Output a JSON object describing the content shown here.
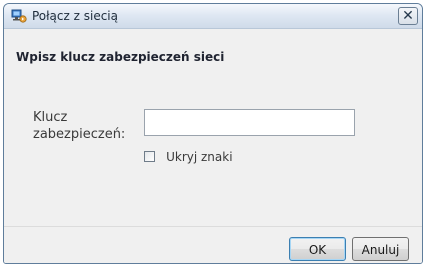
{
  "window": {
    "title": "Połącz z siecią",
    "close_label": "✕"
  },
  "main": {
    "heading": "Wpisz klucz zabezpieczeń sieci",
    "key_label": "Klucz zabezpieczeń:",
    "key_value": "",
    "hide_chars_label": "Ukryj znaki",
    "hide_chars_checked": false
  },
  "footer": {
    "ok_label": "OK",
    "cancel_label": "Anuluj"
  },
  "icons": {
    "app": "network-connect-icon",
    "close": "close-icon",
    "checkbox": "checkbox-icon"
  }
}
